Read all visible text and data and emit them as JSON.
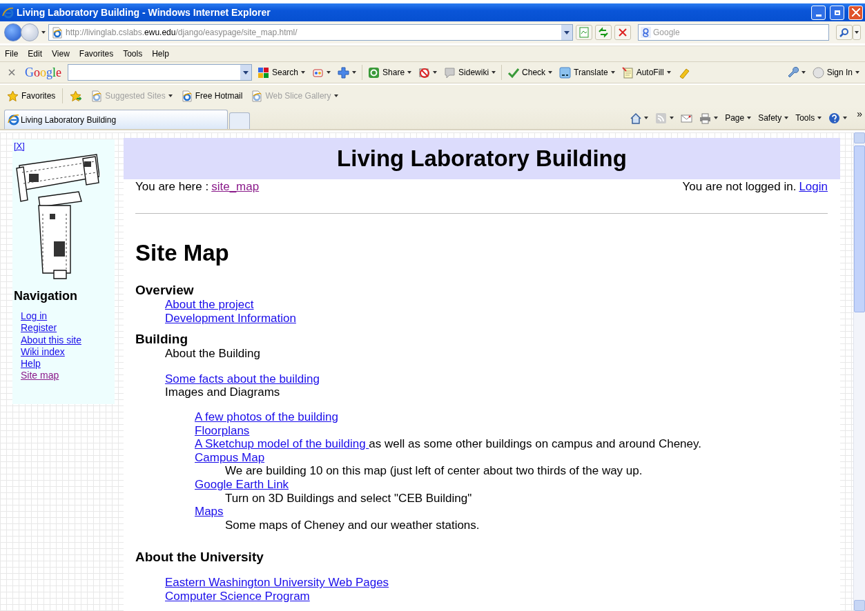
{
  "window": {
    "title": "Living Laboratory Building - Windows Internet Explorer"
  },
  "address_bar": {
    "url": "http://livinglab.cslabs.**ewu.edu**/django/easypage/site_map.html/",
    "search_placeholder": "Google"
  },
  "menu": [
    "File",
    "Edit",
    "View",
    "Favorites",
    "Tools",
    "Help"
  ],
  "google_toolbar": {
    "logo": "Google",
    "items": [
      {
        "kind": "tiles",
        "label": "Search",
        "dropdown": true
      },
      {
        "kind": "gadget",
        "dropdown": true
      },
      {
        "kind": "plus",
        "dropdown": true
      },
      {
        "kind": "share",
        "label": "Share",
        "dropdown": true
      },
      {
        "kind": "block",
        "dropdown": true
      },
      {
        "kind": "bubble",
        "label": "Sidewiki",
        "dropdown": true
      },
      {
        "kind": "check",
        "label": "Check",
        "dropdown": true
      },
      {
        "kind": "translate",
        "label": "Translate",
        "dropdown": true
      },
      {
        "kind": "notepad",
        "label": "AutoFill",
        "dropdown": true
      },
      {
        "kind": "marker",
        "dropdown": false
      }
    ],
    "right_items": [
      {
        "kind": "wrench",
        "dropdown": true
      },
      {
        "kind": "person",
        "label": "Sign In",
        "dropdown": true
      }
    ]
  },
  "favorites_bar": {
    "label": "Favorites",
    "items": [
      {
        "label": "Suggested Sites",
        "dimmed": true,
        "dropdown": true
      },
      {
        "label": "Free Hotmail",
        "dimmed": false,
        "dropdown": false
      },
      {
        "label": "Web Slice Gallery",
        "dimmed": true,
        "dropdown": true
      }
    ]
  },
  "tabs": [
    {
      "title": "Living Laboratory Building",
      "selected": true
    }
  ],
  "command_bar": {
    "items": [
      {
        "kind": "home",
        "dropdown": true
      },
      {
        "kind": "feeds",
        "dropdown": true
      },
      {
        "kind": "mail",
        "dropdown": false
      },
      {
        "kind": "print",
        "dropdown": true
      },
      {
        "kind": "text",
        "label": "Page",
        "dropdown": true
      },
      {
        "kind": "text",
        "label": "Safety",
        "dropdown": true
      },
      {
        "kind": "text",
        "label": "Tools",
        "dropdown": true
      },
      {
        "kind": "help",
        "dropdown": true
      }
    ],
    "overflow": "»"
  },
  "page": {
    "sidebar": {
      "close": "[X]",
      "heading": "Navigation",
      "links": [
        {
          "label": "Log in",
          "visited": false
        },
        {
          "label": "Register",
          "visited": false
        },
        {
          "label": "About this site",
          "visited": false
        },
        {
          "label": "Wiki index",
          "visited": false
        },
        {
          "label": "Help",
          "visited": false
        },
        {
          "label": "Site map",
          "visited": true
        }
      ]
    },
    "header": "Living Laboratory Building",
    "breadcrumb": {
      "prefix": "You are here :",
      "link": "site_map",
      "visited": true
    },
    "login": {
      "status": "You are not logged in.",
      "link": "Login"
    },
    "title": "Site Map",
    "sections": [
      {
        "heading": "Overview",
        "gap": false,
        "items": [
          {
            "kind": "link",
            "text": "About the project"
          },
          {
            "kind": "link",
            "text": "Development Information"
          }
        ]
      },
      {
        "heading": "Building",
        "gap": false,
        "items": [
          {
            "kind": "text",
            "text": "About the Building"
          },
          {
            "kind": "link",
            "text": "Some facts about the building"
          },
          {
            "kind": "text",
            "text": "Images and Diagrams",
            "children": [
              {
                "link": "A few photos of the building"
              },
              {
                "link": "Floorplans"
              },
              {
                "link": "A Sketchup model of the building ",
                "suffix": "as well as some other buildings on campus and around Cheney."
              },
              {
                "link": "Campus Map",
                "note": "We are building 10 on this map (just left of center about two thirds of the way up."
              },
              {
                "link": "Google Earth Link",
                "note": "Turn on 3D Buildings and select \"CEB Building\""
              },
              {
                "link": "Maps",
                "note": "Some maps of Cheney and our weather stations."
              }
            ]
          }
        ]
      },
      {
        "heading": "About the University",
        "gap": true,
        "items": [
          {
            "kind": "link",
            "text": "Eastern Washington University Web Pages"
          },
          {
            "kind": "link",
            "text": "Computer Science Program"
          }
        ]
      }
    ]
  }
}
